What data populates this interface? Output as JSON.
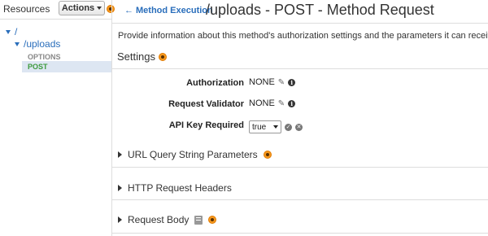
{
  "left": {
    "title": "Resources",
    "actions_label": "Actions",
    "tree": [
      {
        "label": "/"
      },
      {
        "label": "/uploads"
      }
    ],
    "methods": [
      {
        "label": "OPTIONS"
      },
      {
        "label": "POST",
        "selected": true
      }
    ]
  },
  "header": {
    "back_label": "Method Execution",
    "title": "/uploads - POST - Method Request"
  },
  "description": "Provide information about this method's authorization settings and the parameters it can receive.",
  "settings": {
    "heading": "Settings",
    "rows": [
      {
        "label": "Authorization",
        "value": "NONE"
      },
      {
        "label": "Request Validator",
        "value": "NONE"
      },
      {
        "label": "API Key Required",
        "value": "true"
      }
    ]
  },
  "sections": [
    {
      "label": "URL Query String Parameters"
    },
    {
      "label": "HTTP Request Headers"
    },
    {
      "label": "Request Body"
    }
  ],
  "colors": {
    "link": "#2a6ebb",
    "post_method": "#3d9a3d",
    "highlight": "#f79a20"
  }
}
